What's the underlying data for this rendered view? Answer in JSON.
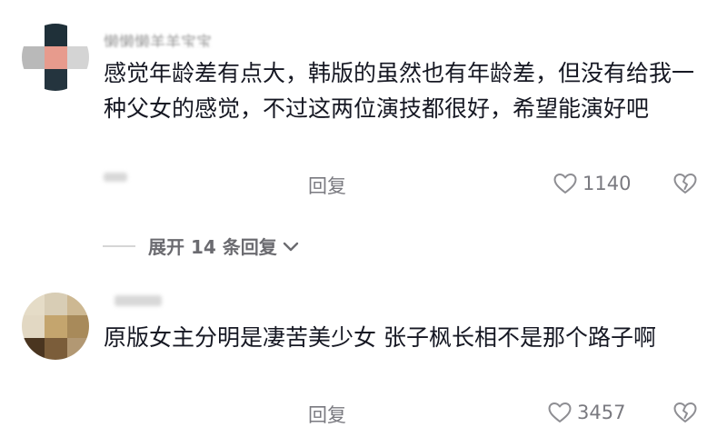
{
  "comments": [
    {
      "username": "懒懒懒羊羊宝宝",
      "text": "感觉年龄差有点大，韩版的虽然也有年龄差，但没有给我一种父女的感觉，不过这两位演技都很好，希望能演好吧",
      "reply_label": "回复",
      "likes": "1140",
      "avatar_colors": [
        "#1f3039",
        "#e79b8d",
        "#c7c7c7",
        "#24343e"
      ]
    },
    {
      "username": "",
      "text": "原版女主分明是凄苦美少女 张子枫长相不是那个路子啊",
      "reply_label": "回复",
      "likes": "3457",
      "avatar_colors": [
        "#d8cdb5",
        "#c4a56e",
        "#4a3520",
        "#e5dcc7"
      ]
    }
  ],
  "expand_replies": "展开 14 条回复",
  "icons": {
    "like": "heart-outline-icon",
    "dislike": "broken-heart-icon",
    "expand": "chevron-down-icon"
  },
  "colors": {
    "text": "#161823",
    "secondary": "#7a7a80"
  }
}
